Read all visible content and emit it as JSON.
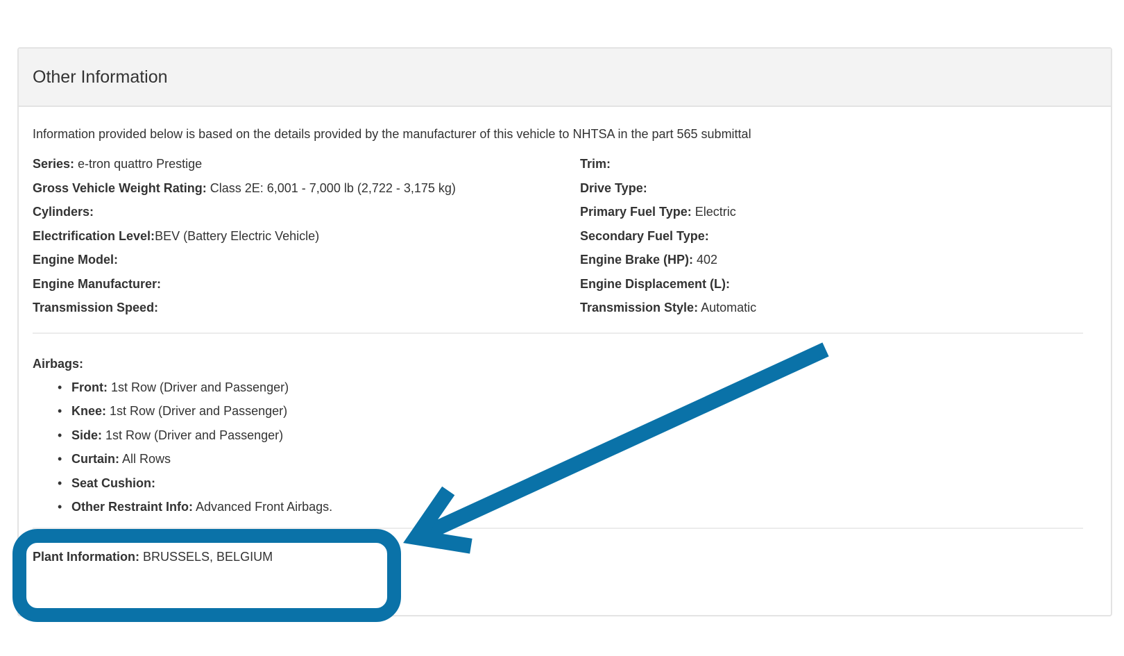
{
  "panel": {
    "title": "Other Information",
    "intro": "Information provided below is based on the details provided by the manufacturer of this vehicle to NHTSA in the part 565 submittal"
  },
  "specs": {
    "left": [
      {
        "label": "Series:",
        "value": " e-tron quattro Prestige"
      },
      {
        "label": "Gross Vehicle Weight Rating:",
        "value": " Class 2E: 6,001 - 7,000 lb (2,722 - 3,175 kg)"
      },
      {
        "label": "Cylinders:",
        "value": ""
      },
      {
        "label": "Electrification Level:",
        "value": "BEV (Battery Electric Vehicle)"
      },
      {
        "label": "Engine Model:",
        "value": ""
      },
      {
        "label": "Engine Manufacturer:",
        "value": ""
      },
      {
        "label": "Transmission Speed:",
        "value": ""
      }
    ],
    "right": [
      {
        "label": "Trim:",
        "value": ""
      },
      {
        "label": "Drive Type:",
        "value": ""
      },
      {
        "label": "Primary Fuel Type:",
        "value": " Electric"
      },
      {
        "label": "Secondary Fuel Type:",
        "value": ""
      },
      {
        "label": "Engine Brake (HP):",
        "value": " 402"
      },
      {
        "label": "Engine Displacement (L):",
        "value": ""
      },
      {
        "label": "Transmission Style:",
        "value": " Automatic"
      }
    ]
  },
  "airbags": {
    "title": "Airbags:",
    "bullet": "•",
    "items": [
      {
        "label": "Front:",
        "value": " 1st Row (Driver and Passenger)"
      },
      {
        "label": "Knee:",
        "value": " 1st Row (Driver and Passenger)"
      },
      {
        "label": "Side:",
        "value": " 1st Row (Driver and Passenger)"
      },
      {
        "label": "Curtain:",
        "value": " All Rows"
      },
      {
        "label": "Seat Cushion:",
        "value": ""
      },
      {
        "label": "Other Restraint Info:",
        "value": " Advanced Front Airbags."
      }
    ]
  },
  "plant": {
    "label": "Plant Information:",
    "value": " BRUSSELS, BELGIUM"
  },
  "annotation": {
    "color": "#0a72a8"
  }
}
